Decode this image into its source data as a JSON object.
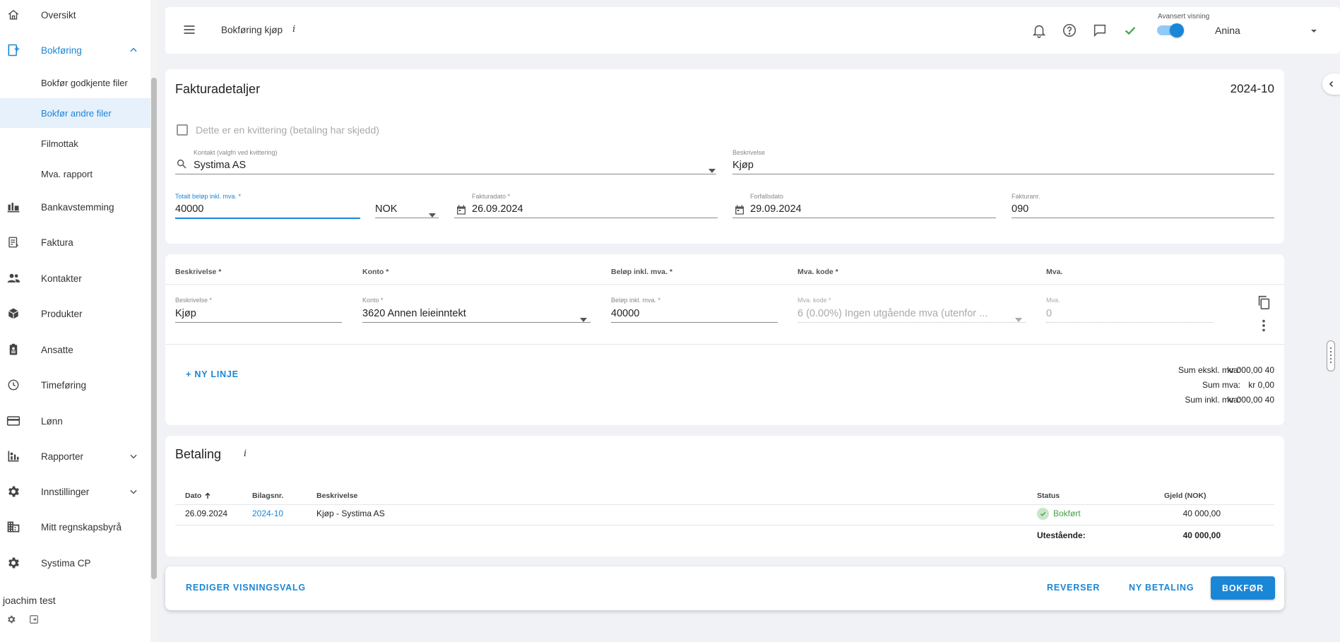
{
  "sidebar": {
    "items": [
      {
        "label": "Oversikt",
        "icon": "home-icon"
      },
      {
        "label": "Bokføring",
        "icon": "book-add-icon"
      },
      {
        "label": "Bankavstemming",
        "icon": "bank-icon"
      },
      {
        "label": "Faktura",
        "icon": "invoice-icon"
      },
      {
        "label": "Kontakter",
        "icon": "people-icon"
      },
      {
        "label": "Produkter",
        "icon": "box-icon"
      },
      {
        "label": "Ansatte",
        "icon": "badge-icon"
      },
      {
        "label": "Timeføring",
        "icon": "clock-icon"
      },
      {
        "label": "Lønn",
        "icon": "card-icon"
      },
      {
        "label": "Rapporter",
        "icon": "report-icon"
      },
      {
        "label": "Innstillinger",
        "icon": "gear-icon"
      },
      {
        "label": "Mitt regnskapsbyrå",
        "icon": "building-icon"
      },
      {
        "label": "Systima CP",
        "icon": "gear-icon"
      }
    ],
    "sub_items": [
      {
        "label": "Bokfør godkjente filer"
      },
      {
        "label": "Bokfør andre filer"
      },
      {
        "label": "Filmottak"
      },
      {
        "label": "Mva. rapport"
      }
    ],
    "user_name": "joachim test"
  },
  "header": {
    "title": "Bokføring kjøp",
    "info": "i",
    "advanced_label": "Avansert visning",
    "advanced_on": true,
    "user": "Anina"
  },
  "invoice": {
    "title": "Fakturadetaljer",
    "period": "2024-10",
    "receipt_label": "Dette er en kvittering (betaling har skjedd)",
    "contact_label": "Kontakt (valgfri ved kvittering)",
    "contact_value": "Systima AS",
    "description_label": "Beskrivelse",
    "description_value": "Kjøp",
    "total_label": "Totalt beløp inkl. mva. *",
    "total_value": "40000",
    "currency": "NOK",
    "invoice_date_label": "Fakturadato *",
    "invoice_date": "26.09.2024",
    "due_date_label": "Forfallsdato",
    "due_date": "29.09.2024",
    "invoice_no_label": "Fakturanr.",
    "invoice_no": "090"
  },
  "lines": {
    "headers": [
      "Beskrivelse *",
      "Konto *",
      "Beløp inkl. mva. *",
      "Mva. kode *",
      "Mva."
    ],
    "row": {
      "description_label": "Beskrivelse *",
      "description": "Kjøp",
      "account_label": "Konto *",
      "account": "3620 Annen leieinntekt",
      "amount_label": "Beløp inkl. mva. *",
      "amount": "40000",
      "vat_code_label": "Mva. kode *",
      "vat_code": "6 (0.00%) Ingen utgående mva (utenfor ...",
      "vat_label": "Mva.",
      "vat": "0"
    },
    "new_line": "+ NY LINJE",
    "sums": [
      {
        "label": "Sum ekskl. mva:",
        "value": "40 000,00 kr"
      },
      {
        "label": "Sum mva:",
        "value": "0,00 kr"
      },
      {
        "label": "Sum inkl. mva:",
        "value": "40 000,00 kr"
      }
    ]
  },
  "payment": {
    "title": "Betaling",
    "info": "i",
    "columns": {
      "date": "Dato",
      "voucher": "Bilagsnr.",
      "description": "Beskrivelse",
      "status": "Status",
      "debt": "Gjeld (NOK)"
    },
    "rows": [
      {
        "date": "26.09.2024",
        "voucher": "2024-10",
        "description": "Kjøp - Systima AS",
        "status": "Bokført",
        "debt": "40 000,00"
      }
    ],
    "outstanding_label": "Utestående:",
    "outstanding_value": "40 000,00"
  },
  "footer": {
    "edit_view": "REDIGER VISNINGSVALG",
    "reverse": "REVERSER",
    "new_payment": "NY BETALING",
    "post": "BOKFØR"
  },
  "colors": {
    "accent": "#1a86d6",
    "success": "#43a047"
  }
}
